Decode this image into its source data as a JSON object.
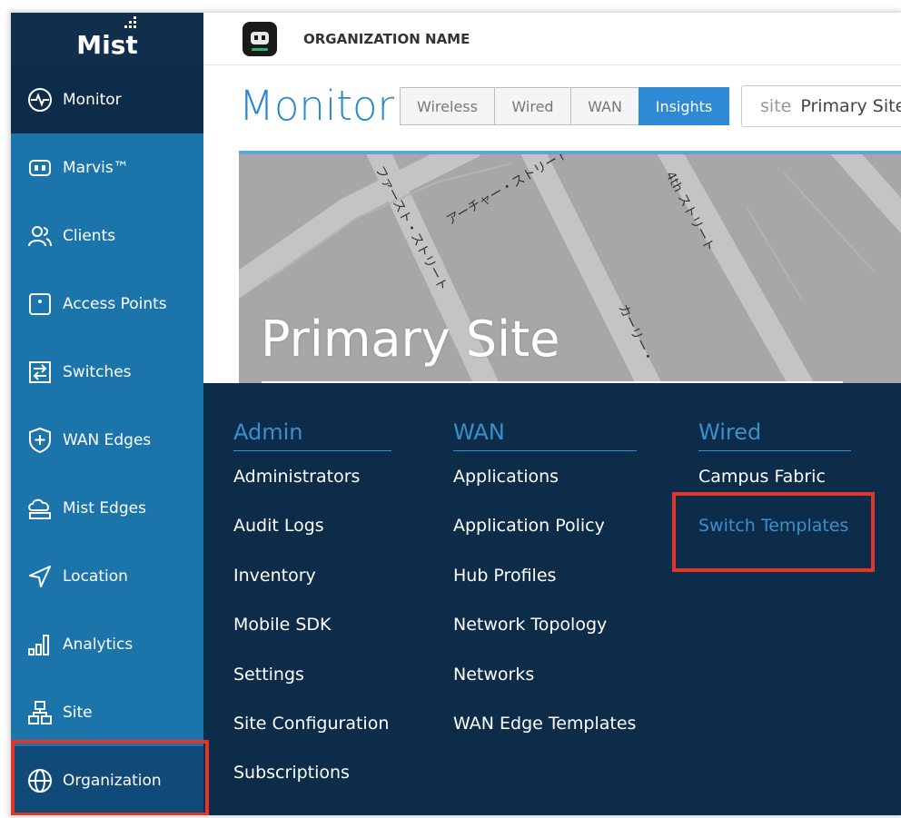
{
  "app": {
    "logo": "Mist"
  },
  "sidebar": {
    "items": [
      {
        "label": "Monitor",
        "icon": "monitor-icon"
      },
      {
        "label": "Marvis™",
        "icon": "marvis-icon"
      },
      {
        "label": "Clients",
        "icon": "clients-icon"
      },
      {
        "label": "Access Points",
        "icon": "access-point-icon"
      },
      {
        "label": "Switches",
        "icon": "switch-icon"
      },
      {
        "label": "WAN Edges",
        "icon": "wan-edge-icon"
      },
      {
        "label": "Mist Edges",
        "icon": "mist-edge-icon"
      },
      {
        "label": "Location",
        "icon": "location-icon"
      },
      {
        "label": "Analytics",
        "icon": "analytics-icon"
      },
      {
        "label": "Site",
        "icon": "site-icon"
      },
      {
        "label": "Organization",
        "icon": "globe-icon"
      }
    ]
  },
  "header": {
    "org_name": "ORGANIZATION NAME"
  },
  "page": {
    "title": "Monitor",
    "tabs": [
      "Wireless",
      "Wired",
      "WAN",
      "Insights"
    ],
    "selected_tab": "Insights",
    "site_label": "site",
    "site_value": "Primary Site"
  },
  "map": {
    "site_title": "Primary Site",
    "street_labels": [
      "ファースト・ストリート",
      "アーチャー・ストリート",
      "4th ストリート",
      "カーリー・"
    ]
  },
  "menu": {
    "admin": {
      "heading": "Admin",
      "items": [
        "Administrators",
        "Audit Logs",
        "Inventory",
        "Mobile SDK",
        "Settings",
        "Site Configuration",
        "Subscriptions"
      ]
    },
    "wan": {
      "heading": "WAN",
      "items": [
        "Applications",
        "Application Policy",
        "Hub Profiles",
        "Network Topology",
        "Networks",
        "WAN Edge Templates"
      ]
    },
    "wired": {
      "heading": "Wired",
      "items": [
        "Campus Fabric",
        "Switch Templates"
      ]
    }
  },
  "colors": {
    "sidebar": "#1c75aa",
    "sidebar_active": "#0c2c4a",
    "menu_bg": "#0c2c4a",
    "accent": "#3b8fcb",
    "highlight": "#e0352b"
  }
}
